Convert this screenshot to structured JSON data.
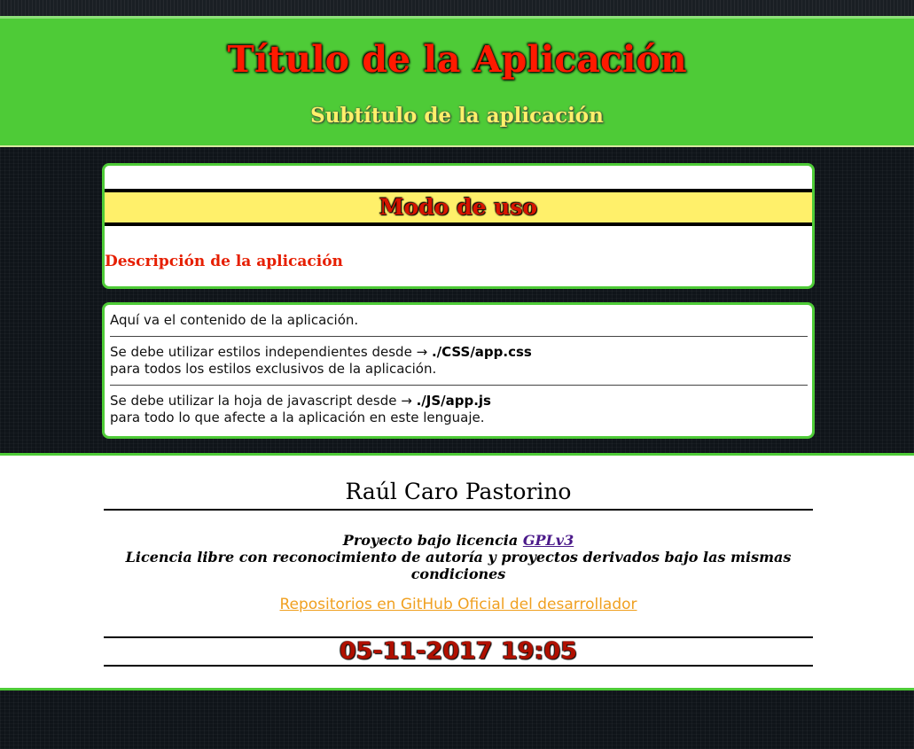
{
  "header": {
    "title": "Título de la Aplicación",
    "subtitle": "Subtítulo de la aplicación"
  },
  "usage": {
    "heading": "Modo de uso",
    "description": "Descripción de la aplicación"
  },
  "content": {
    "intro": "Aquí va el contenido de la aplicación.",
    "css_line": "Se debe utilizar estilos independientes desde →",
    "css_path": "./CSS/app.css",
    "css_note": "para todos los estilos exclusivos de la aplicación.",
    "js_line": "Se debe utilizar la hoja de javascript desde →",
    "js_path": "./JS/app.js",
    "js_note": "para todo lo que afecte a la aplicación en este lenguaje."
  },
  "footer": {
    "author": "Raúl Caro Pastorino",
    "license_prefix": "Proyecto bajo licencia",
    "license_link": "GPLv3",
    "license_desc": "Licencia libre con reconocimiento de autoría y proyectos derivados bajo las mismas condiciones",
    "repos_link": "Repositorios en GitHub Oficial del desarrollador",
    "datetime": "05-11-2017 19:05"
  },
  "colors": {
    "accent_green": "#4ecb37",
    "title_red": "#ff1a00",
    "highlight_yellow": "#fff06a",
    "link_orange": "#f0a020"
  }
}
